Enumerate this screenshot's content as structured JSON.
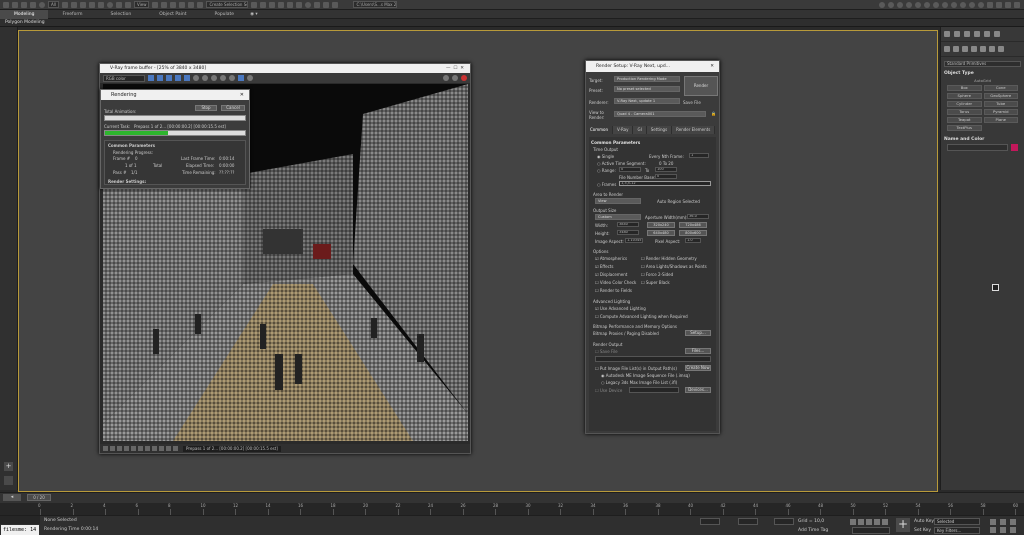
{
  "main_toolbar": {
    "layers_label": "All",
    "selection_set_placeholder": "Create Selection Se",
    "workspace_label": "C:\\Users\\S...s Max 2020"
  },
  "ribbon": {
    "tabs": [
      "Modeling",
      "Freeform",
      "Selection",
      "Object Paint",
      "Populate"
    ],
    "active_panel": "Polygon Modeling"
  },
  "command_panel": {
    "category": "Standard Primitives",
    "object_type_header": "Object Type",
    "autogrid_label": "AutoGrid",
    "object_buttons": [
      "Box",
      "Cone",
      "Sphere",
      "GeoSphere",
      "Cylinder",
      "Tube",
      "Torus",
      "Pyramid",
      "Teapot",
      "Plane",
      "TextPlus"
    ],
    "name_color_header": "Name and Color",
    "colors": {
      "object_color": "#c2185b"
    }
  },
  "frame_buffer": {
    "title": "V-Ray frame buffer - [25% of 3840 x 3480]",
    "channel": "RGB color",
    "status_text": "Prepass 1 of 2... [00:00:00.2] [00:00:15.5 est]"
  },
  "rendering_dialog": {
    "title": "Rendering",
    "stop_label": "Stop",
    "cancel_label": "Cancel",
    "total_animation_label": "Total Animation:",
    "current_task_label": "Current Task:",
    "current_task_value": "Prepass 1 of 2... [00:00:00.2] [00:00:15.5 est]",
    "progress": 0.45,
    "section_header": "Common Parameters",
    "rendering_progress_label": "Rendering Progress:",
    "frame_label": "Frame #",
    "frame_value": "0",
    "frame_count": "1 of 1",
    "total_label": "Total",
    "pass_label": "Pass #",
    "pass_value": "1/1",
    "last_frame_time_label": "Last Frame Time:",
    "last_frame_time_value": "0:00:14",
    "elapsed_time_label": "Elapsed Time:",
    "elapsed_time_value": "0:00:00",
    "time_remaining_label": "Time Remaining:",
    "time_remaining_value": "??:??:??",
    "render_settings_label": "Render Settings:"
  },
  "render_setup": {
    "title": "Render Setup: V-Ray Next, upd...",
    "target_label": "Target:",
    "target_value": "Production Rendering Mode",
    "preset_label": "Preset:",
    "preset_value": "No preset selected",
    "renderer_label": "Renderer:",
    "renderer_value": "V-Ray Next, update 1",
    "save_file_label": "Save File",
    "view_to_render_label": "View to Render:",
    "view_value": "Quad 4 - Camera001",
    "render_button": "Render",
    "tabs": [
      "Common",
      "V-Ray",
      "GI",
      "Settings",
      "Render Elements"
    ],
    "common_params_header": "Common Parameters",
    "time_output_label": "Time Output",
    "single_label": "Single",
    "every_nth_label": "Every Nth Frame:",
    "every_nth_value": "1",
    "active_segment_label": "Active Time Segment:",
    "active_segment_value": "0 To 20",
    "range_label": "Range:",
    "range_from": "0",
    "range_to_label": "To",
    "range_to": "100",
    "file_number_base_label": "File Number Base:",
    "file_number_base_value": "0",
    "frames_label": "Frames",
    "frames_value": "1,3,5-12",
    "area_label": "Area to Render",
    "area_value": "View",
    "auto_region_label": "Auto Region Selected",
    "output_size_label": "Output Size",
    "output_size_preset": "Custom",
    "aperture_label": "Aperture Width(mm):",
    "aperture_value": "36.0",
    "width_label": "Width:",
    "width_value": "3840",
    "height_label": "Height:",
    "height_value": "3480",
    "size_presets": [
      "320x240",
      "720x486",
      "640x480",
      "800x600"
    ],
    "image_aspect_label": "Image Aspect:",
    "image_aspect_value": "1.10345",
    "pixel_aspect_label": "Pixel Aspect:",
    "pixel_aspect_value": "1.0",
    "options_label": "Options",
    "options": [
      "Atmospherics",
      "Render Hidden Geometry",
      "Effects",
      "Area Lights/Shadows as Points",
      "Displacement",
      "Force 2-Sided",
      "Video Color Check",
      "Super Black",
      "Render to Fields"
    ],
    "adv_lighting_label": "Advanced Lighting",
    "use_adv_label": "Use Advanced Lighting",
    "compute_adv_label": "Compute Advanced Lighting when Required",
    "bitmap_perf_label": "Bitmap Performance and Memory Options",
    "bitmap_proxies_label": "Bitmap Proxies / Paging Disabled",
    "setup_button": "Setup...",
    "render_output_label": "Render Output",
    "save_file_output_label": "Save File",
    "files_button": "Files...",
    "put_image_label": "Put Image File List(s) in Output Path(s)",
    "create_now_button": "Create Now",
    "autodesk_seq_label": "Autodesk ME Image Sequence File (.imsq)",
    "legacy_label": "Legacy 3ds Max Image File List (.ifl)",
    "use_device_label": "Use Device",
    "devices_button": "Devices..."
  },
  "timeline": {
    "slider_label": "0 / 20",
    "ticks": [
      "0",
      "2",
      "4",
      "6",
      "8",
      "10",
      "12",
      "14",
      "16",
      "18",
      "20",
      "22",
      "24",
      "26",
      "28",
      "30",
      "32",
      "34",
      "36",
      "38",
      "40",
      "42",
      "44",
      "46",
      "48",
      "50",
      "52",
      "54",
      "56",
      "58",
      "60"
    ]
  },
  "status_bar": {
    "maxscript": "filesme: 14",
    "selection_status": "None Selected",
    "rendering_time": "Rendering Time 0:00:14",
    "grid_label": "Grid = 10,0",
    "add_time_tag": "Add Time Tag",
    "auto_key": "Auto Key",
    "set_key": "Set Key",
    "selected_label": "Selected",
    "key_filters": "Key Filters..."
  }
}
